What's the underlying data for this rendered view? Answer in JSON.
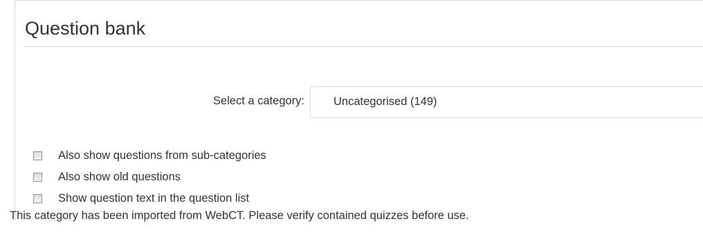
{
  "page": {
    "title": "Question bank"
  },
  "category": {
    "label": "Select a category:",
    "selected": "Uncategorised (149)"
  },
  "options": [
    {
      "label": "Also show questions from sub-categories",
      "checked": false
    },
    {
      "label": "Also show old questions",
      "checked": false
    },
    {
      "label": "Show question text in the question list",
      "checked": false
    }
  ],
  "notice": "This category has been imported from WebCT. Please verify contained quizzes before use."
}
